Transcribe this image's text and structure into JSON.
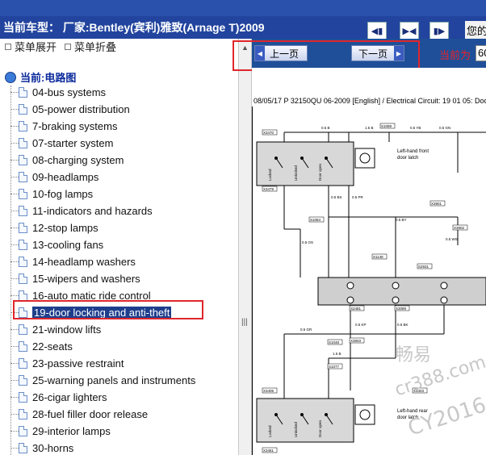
{
  "header": {
    "model_title": "当前车型： 厂家:Bentley(宾利)雅致(Arnage T)2009",
    "right_text": "您的"
  },
  "toolbar": {
    "expand_label": "菜单展开",
    "collapse_label": "菜单折叠"
  },
  "tree": {
    "root_label": "当前:电路图",
    "items": [
      {
        "label": "04-bus systems"
      },
      {
        "label": "05-power distribution"
      },
      {
        "label": "7-braking systems"
      },
      {
        "label": "07-starter system"
      },
      {
        "label": "08-charging system"
      },
      {
        "label": "09-headlamps"
      },
      {
        "label": "10-fog lamps"
      },
      {
        "label": "11-indicators and hazards"
      },
      {
        "label": "12-stop lamps"
      },
      {
        "label": "13-cooling fans"
      },
      {
        "label": "14-headlamp washers"
      },
      {
        "label": "15-wipers and washers"
      },
      {
        "label": "16-auto matic ride control"
      },
      {
        "label": "19-door locking and anti-theft",
        "selected": true
      },
      {
        "label": "21-window lifts"
      },
      {
        "label": "22-seats"
      },
      {
        "label": "23-passive restraint"
      },
      {
        "label": "25-warning panels and instruments"
      },
      {
        "label": "26-cigar lighters"
      },
      {
        "label": "28-fuel filler door release"
      },
      {
        "label": "29-interior lamps"
      },
      {
        "label": "30-horns"
      }
    ]
  },
  "page_nav": {
    "prev_label": "上一页",
    "next_label": "下一页",
    "current_label": "当前为",
    "current_value": "60"
  },
  "diagram": {
    "header_text": "08/05/17  P 32150QU 06-2009 [English] / Electrical Circuit: 19 01 05: Door",
    "latch_top_label_1": "Left-hand front",
    "latch_top_label_2": "door latch",
    "latch_bottom_label_1": "Left-hand rear",
    "latch_bottom_label_2": "door latch",
    "latch_switch_labels": [
      "Locked",
      "Unlocked",
      "Door open"
    ],
    "connector_labels": [
      "X3470",
      "X3479",
      "S1084",
      "S1089",
      "X3901",
      "X3902",
      "S1148",
      "S2931",
      "S2481",
      "S3089",
      "X3903",
      "X3405",
      "X3403",
      "X3451",
      "S1048",
      "S1077"
    ],
    "wire_labels": [
      "0.5 B",
      "1.5 B",
      "0.5 YB",
      "0.5 GN",
      "0.5 BS",
      "0.5 PR",
      "0.5 OS",
      "0.5 BY",
      "0.5 WS",
      "0.5 KP",
      "0.5 BK",
      "0.5 GR",
      "1.5 B"
    ],
    "watermark_1": "畅易",
    "watermark_2": "cr388.com",
    "watermark_3": "CY2016"
  }
}
